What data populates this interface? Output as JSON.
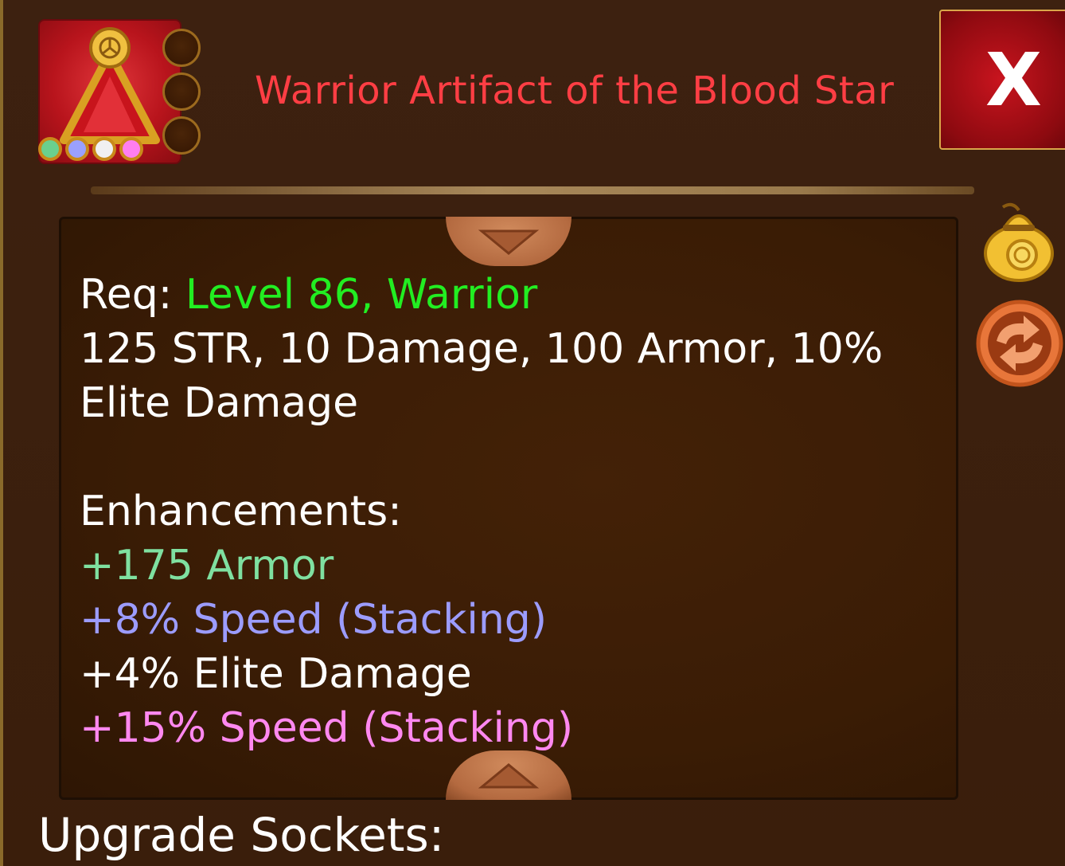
{
  "item": {
    "title": "Warrior Artifact of the Blood Star",
    "icon": "artifact-pendant-icon",
    "gem_colors": [
      "#6ad08e",
      "#9aa0ff",
      "#f0f0f0",
      "#ff7ef0"
    ],
    "socket_count": 3
  },
  "close_button": {
    "label": "X"
  },
  "requirements": {
    "prefix": "Req: ",
    "level": "Level 86",
    "separator": ", ",
    "class": "Warrior"
  },
  "stats": {
    "line1": "125 STR, 10 Damage, 100 Armor, 10%",
    "line2": "Elite Damage"
  },
  "enhancements": {
    "heading": "Enhancements:",
    "items": [
      "+175 Armor",
      "+8% Speed (Stacking)",
      "+4% Elite Damage",
      "+15% Speed (Stacking)"
    ]
  },
  "side_actions": [
    {
      "icon": "gold-bag-icon"
    },
    {
      "icon": "swap-arrows-icon"
    }
  ],
  "footer": {
    "label": "Upgrade Sockets:"
  }
}
